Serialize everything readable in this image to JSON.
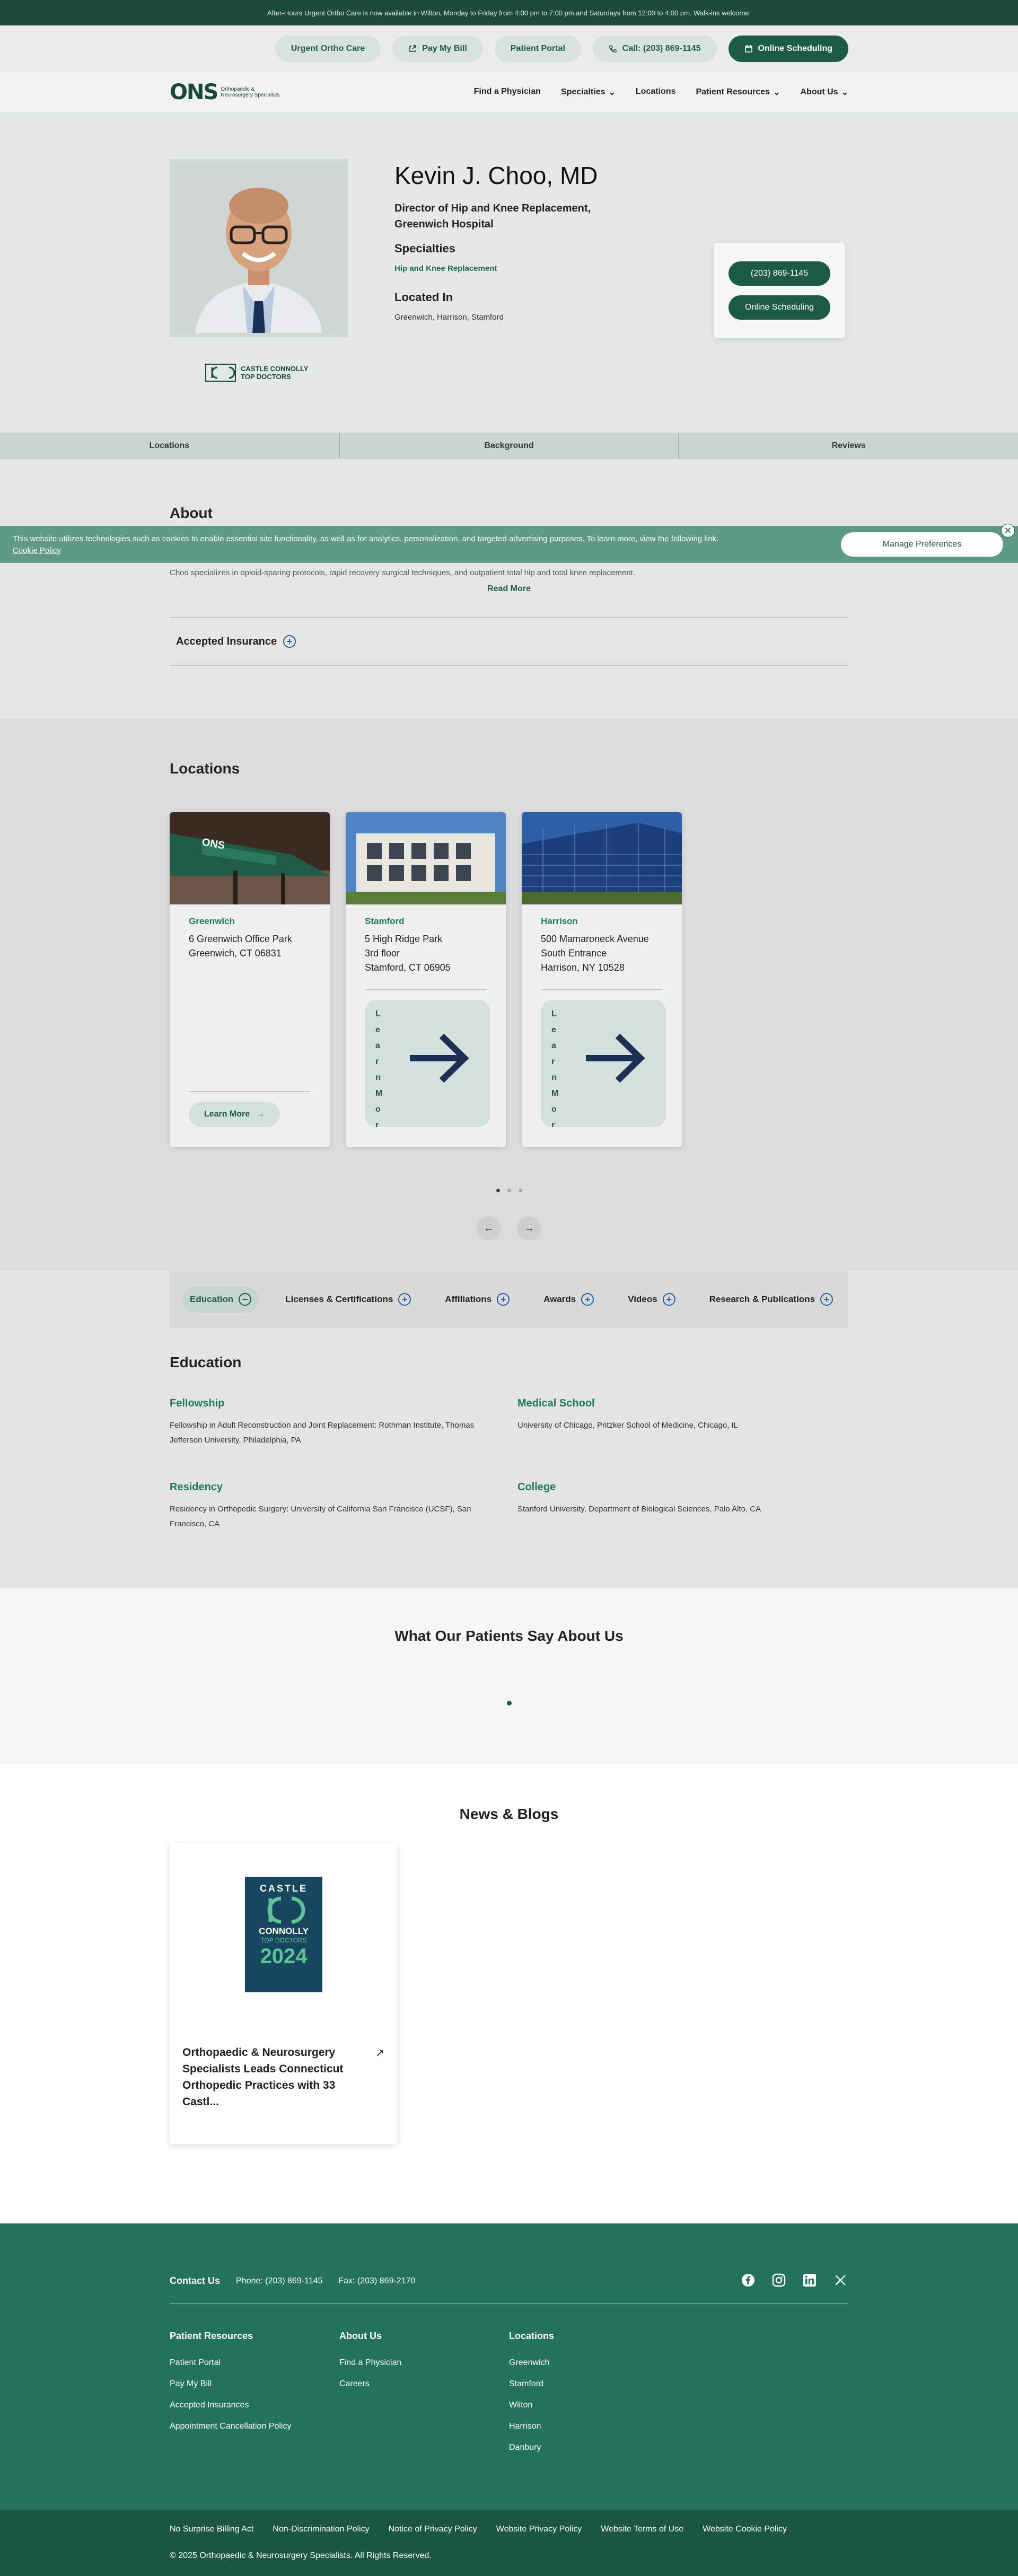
{
  "announcement": "After-Hours Urgent Ortho Care is now available in Wilton, Monday to Friday from 4:00 pm to 7:00 pm and Saturdays from 12:00 to 4:00 pm. Walk-ins welcome.",
  "utility": {
    "urgent": "Urgent Ortho Care",
    "pay": "Pay My Bill",
    "portal": "Patient Portal",
    "call": "Call: (203) 869-1145",
    "schedule": "Online Scheduling"
  },
  "brand": {
    "mark": "ONS",
    "sub": "Orthopaedic & Neurosurgery Specialists"
  },
  "nav": {
    "find": "Find a Physician",
    "specialties": "Specialties",
    "locations": "Locations",
    "resources": "Patient Resources",
    "about": "About Us"
  },
  "doctor": {
    "name": "Kevin J. Choo, MD",
    "title": "Director of Hip and Knee Replacement, Greenwich Hospital",
    "specialties_label": "Specialties",
    "specialties_value": "Hip and Knee Replacement",
    "located_label": "Located In",
    "located_value": "Greenwich, Harrison, Stamford",
    "phone": "(203) 869-1145",
    "schedule": "Online Scheduling",
    "award": "CASTLE CONNOLLY TOP DOCTORS"
  },
  "tabs": [
    "Locations",
    "Background",
    "Reviews"
  ],
  "about": {
    "heading": "About",
    "body": "Kevin J. Choo, MD, is a board-certified orthopaedic surgeon who specializes in hip and knee replacement. His clinical interests include osteoarthritis, inflammatory arthritis, avascular necrosis, hip dysplasia, and post-traumatic arthrosis. He is fellowship-trained in direct anterior hip replacement, the use of computer- and robotic-assisted technology, and partial knee replacement. Dr. Choo specializes in opioid-sparing protocols, rapid recovery surgical techniques, and outpatient total hip and total knee replacement.",
    "read_more": "Read More",
    "insurance": "Accepted Insurance"
  },
  "cookie": {
    "text": "This website utilizes technologies such as cookies to enable essential site functionality, as well as for analytics, personalization, and targeted advertising purposes. To learn more, view the following link:",
    "link": "Cookie Policy",
    "manage": "Manage Preferences",
    "close": "✕"
  },
  "locations": {
    "heading": "Locations",
    "items": [
      {
        "city": "Greenwich",
        "addr1": "6 Greenwich Office Park",
        "addr2": "Greenwich, CT 06831",
        "addr3": "",
        "cta": "Learn More"
      },
      {
        "city": "Stamford",
        "addr1": "5 High Ridge Park",
        "addr2": "3rd floor",
        "addr3": "Stamford, CT 06905",
        "cta": "Learn More"
      },
      {
        "city": "Harrison",
        "addr1": "500 Mamaroneck Avenue",
        "addr2": "South Entrance",
        "addr3": "Harrison, NY 10528",
        "cta": "Learn More"
      }
    ],
    "prev": "←",
    "next": "→"
  },
  "credentials": {
    "tabs": [
      "Education",
      "Licenses & Certifications",
      "Affiliations",
      "Awards",
      "Videos",
      "Research & Publications"
    ],
    "heading": "Education",
    "fellowship_label": "Fellowship",
    "fellowship": "Fellowship in Adult Reconstruction and Joint Replacement: Rothman Institute, Thomas Jefferson University, Philadelphia, PA",
    "medical_label": "Medical School",
    "medical": "University of Chicago, Pritzker School of Medicine, Chicago, IL",
    "residency_label": "Residency",
    "residency": "Residency in Orthopedic Surgery: University of California San Francisco (UCSF), San Francisco, CA",
    "college_label": "College",
    "college": "Stanford University, Department of Biological Sciences, Palo Alto, CA"
  },
  "testimonials": {
    "heading": "What Our Patients Say About Us"
  },
  "news": {
    "heading": "News & Blogs",
    "thumb_l1": "CASTLE",
    "thumb_l2": "CONNOLLY",
    "thumb_l3": "TOP DOCTORS",
    "thumb_year": "2024",
    "title": "Orthopaedic & Neurosurgery Specialists Leads Connecticut Orthopedic Practices with 33 Castl..."
  },
  "footer": {
    "contact_label": "Contact Us",
    "phone": "Phone: (203) 869-1145",
    "fax": "Fax: (203) 869-2170",
    "col1_title": "Patient Resources",
    "col1": [
      "Patient Portal",
      "Pay My Bill",
      "Accepted Insurances",
      "Appointment Cancellation Policy"
    ],
    "col2_title": "About Us",
    "col2": [
      "Find a Physician",
      "Careers"
    ],
    "col3_title": "Locations",
    "col3": [
      "Greenwich",
      "Stamford",
      "Wilton",
      "Harrison",
      "Danbury"
    ],
    "legal": [
      "No Surprise Billing Act",
      "Non-Discrimination Policy",
      "Notice of Privacy Policy",
      "Website Privacy Policy",
      "Website Terms of Use",
      "Website Cookie Policy"
    ],
    "copyright": "© 2025 Orthopaedic & Neurosurgery Specialists. All Rights Reserved."
  },
  "colors": {
    "brand_dark": "#1c5c46",
    "brand_green": "#23735a",
    "accent_text": "#1f7a56"
  }
}
